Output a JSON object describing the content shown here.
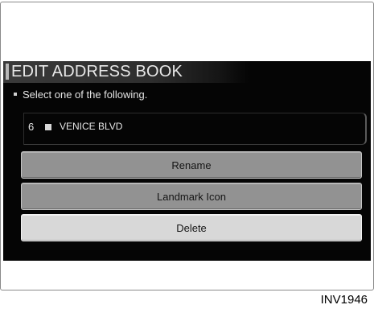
{
  "screen": {
    "title": "EDIT ADDRESS BOOK",
    "instruction": "Select one of the following.",
    "entry": {
      "number": "6",
      "icon": "landmark-square-icon",
      "name": "VENICE BLVD"
    },
    "options": [
      {
        "label": "Rename"
      },
      {
        "label": "Landmark Icon"
      },
      {
        "label": "Delete",
        "selected": true
      }
    ]
  },
  "figure": {
    "code": "INV1946"
  },
  "colors": {
    "screen_bg": "#050505",
    "button_bg": "#929292",
    "button_selected_bg": "#d8d8d8",
    "text_light": "#e6e6e6"
  }
}
